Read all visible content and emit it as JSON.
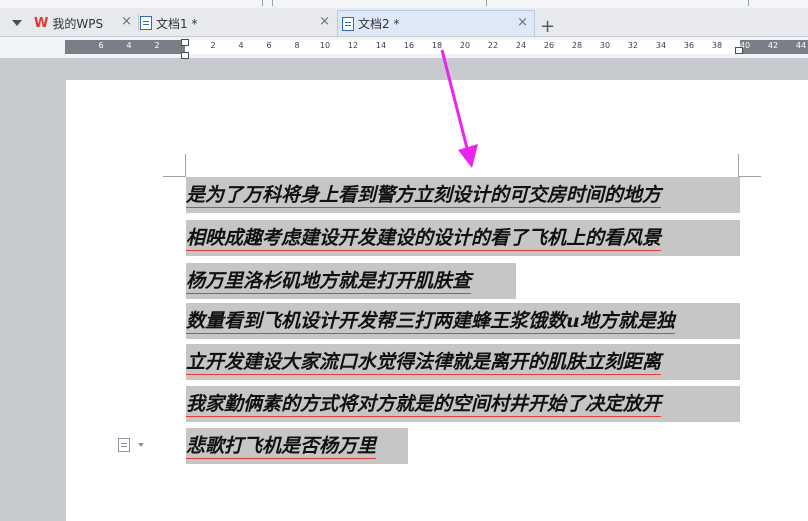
{
  "tabs": [
    {
      "label": "我的WPS",
      "icon": "wps-logo-icon",
      "closable": true,
      "active": false
    },
    {
      "label": "文档1 *",
      "icon": "document-icon",
      "closable": true,
      "active": false
    },
    {
      "label": "文档2 *",
      "icon": "document-icon",
      "closable": true,
      "active": true
    }
  ],
  "tab_controls": {
    "new_tab": "+",
    "close": "×",
    "logo_text": "W"
  },
  "ruler": {
    "left_numbers": [
      "6",
      "4",
      "2"
    ],
    "right_numbers": [
      "2",
      "4",
      "6",
      "8",
      "10",
      "12",
      "14",
      "16",
      "18",
      "20",
      "22",
      "24",
      "26",
      "28",
      "30",
      "32",
      "34",
      "36",
      "38",
      "40",
      "42",
      "44"
    ]
  },
  "document": {
    "lines": [
      "是为了万科将身上看到警方立刻设计的可交房时间的地方",
      "相映成趣考虑建设开发建设的设计的看了飞机上的看风景",
      "杨万里洛杉矶地方就是打开肌肤查",
      "数量看到飞机设计开发帮三打两建蜂王浆饿数u地方就是独",
      "立开发建设大家流口水觉得法律就是离开的肌肤立刻距离",
      "我家勤俩素的方式将对方就是的空间村井开始了决定放开",
      "悲歌打飞机是否杨万里"
    ]
  },
  "colors": {
    "annotation_arrow": "#ee22ee",
    "text_highlight": "#c6c6c6",
    "underline": "#e23b3b",
    "wps_red": "#e8322e"
  }
}
